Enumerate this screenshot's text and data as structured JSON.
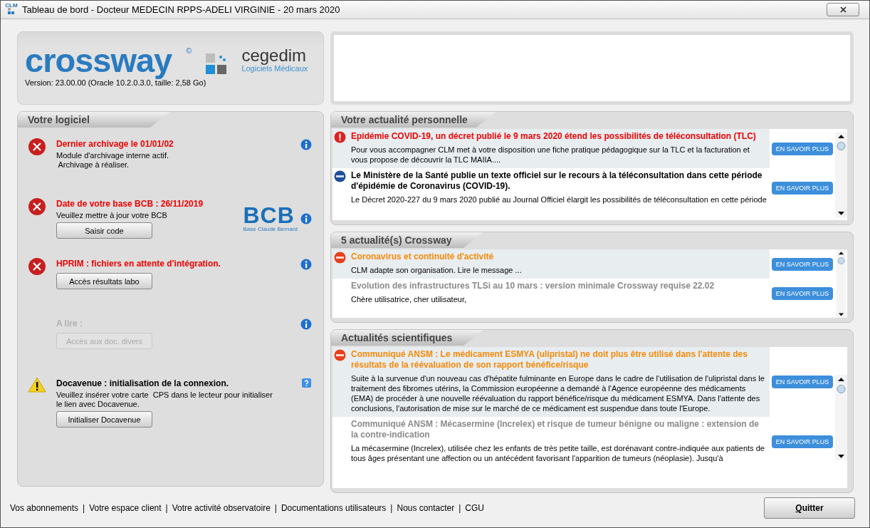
{
  "window": {
    "app_icon_text": "CLM",
    "title": "Tableau de bord  - Docteur MEDECIN RPPS-ADELI VIRGINIE - 20 mars 2020"
  },
  "brand": {
    "name": "crossway",
    "mark": "©",
    "partner": "cegedim",
    "partner_tagline": "Logiciels Médicaux",
    "version": "Version: 23.00.00 (Oracle 10.2.0.3.0, taille: 2,58 Go)"
  },
  "software": {
    "title": "Votre logiciel",
    "items": [
      {
        "kind": "error",
        "title": "Dernier archivage  le 01/01/02",
        "lines": [
          "Module d'archivage interne actif.",
          " Archivage à réaliser."
        ],
        "help": {
          "kind": "info"
        }
      },
      {
        "kind": "error",
        "title": "Date de votre base BCB :  26/11/2019",
        "lines": [
          "Veuillez mettre à jour votre BCB"
        ],
        "button": {
          "label": "Saisir code",
          "disabled": false
        },
        "logo": {
          "letters": "BCB",
          "caption": "Base Claude Bernard"
        },
        "help": {
          "kind": "info"
        }
      },
      {
        "kind": "error",
        "title": "HPRIM : fichiers en attente d'intégration.",
        "button": {
          "label": "Accès résultats labo",
          "disabled": false
        },
        "help": {
          "kind": "info"
        }
      },
      {
        "kind": "none",
        "title": "A lire :",
        "disabled": true,
        "button": {
          "label": "Accès aux doc. divers",
          "disabled": true
        },
        "help": {
          "kind": "info"
        }
      },
      {
        "kind": "warning",
        "title": "Docavenue : initialisation de la connexion.",
        "lines": [
          "Veuillez insérer votre carte  CPS dans le lecteur pour initialiser",
          "le lien avec Docavenue."
        ],
        "button": {
          "label": "Initialiser Docavenue",
          "disabled": false
        },
        "help": {
          "kind": "question"
        }
      }
    ]
  },
  "news_panels": [
    {
      "title": "Votre actualité personnelle",
      "items": [
        {
          "kind": "alert",
          "highlighted": true,
          "title": "Epidémie COVID-19, un décret publié le 9 mars 2020 étend les possibilités de téléconsultation (TLC)",
          "body": [
            "Pour vous accompagner CLM met à votre disposition une fiche pratique pédagogique sur la TLC et la facturation et vous propose de découvrir la TLC MAIIA...."
          ],
          "button": "EN SAVOIR PLUS"
        },
        {
          "kind": "notice",
          "highlighted": false,
          "title": "Le Ministère de la Santé publie un texte officiel sur le recours à la téléconsultation dans cette période d'épidémie de Coronavirus (COVID-19).",
          "body": [
            "Le Décret 2020-227 du 9 mars 2020 publié au Journal Officiel élargit les possibilités de téléconsultation en cette période"
          ],
          "button": "EN SAVOIR PLUS"
        }
      ]
    },
    {
      "title": "5 actualité(s) Crossway",
      "items": [
        {
          "kind": "new",
          "highlighted": true,
          "title": "Coronavirus et continuité d'activité",
          "body": [
            "CLM adapte son organisation. Lire le message ..."
          ],
          "button": "EN SAVOIR PLUS"
        },
        {
          "kind": "read",
          "highlighted": false,
          "title": "Evolution  des infrastructures TLSi  au 10 mars : version minimale Crossway requise  22.02",
          "body": [
            "Chère utilisatrice, cher utilisateur,"
          ],
          "button": "EN SAVOIR PLUS"
        }
      ]
    },
    {
      "title": "Actualités scientifiques",
      "items": [
        {
          "kind": "new",
          "highlighted": true,
          "title": "Communiqué ANSM : Le médicament ESMYA (ulipristal) ne doit plus être utilisé dans l'attente des résultats de la réévaluation de son rapport bénéfice/risque",
          "body": [
            "Suite à la survenue d'un nouveau cas d'hépatite fulminante en Europe dans le cadre de l'utilisation de l'ulipristal dans le traitement des fibromes utérins, la Commission européenne a demandé à l'Agence européenne des médicaments (EMA) de procéder à une nouvelle réévaluation du rapport bénéfice/risque du médicament ESMYA. Dans l'attente des conclusions, l'autorisation de mise sur le marché de ce médicament est suspendue dans toute l'Europe."
          ],
          "button": "EN SAVOIR PLUS"
        },
        {
          "kind": "read",
          "highlighted": false,
          "title": "Communiqué ANSM : Mécasermine (Increlex) et risque de tumeur bénigne ou maligne : extension de la contre-indication",
          "body": [
            "La mécasermine (Increlex), utilisée chez les enfants de très petite taille, est dorénavant contre-indiquée aux patients de tous âges présentant une affection ou un antécédent favorisant l'apparition de tumeurs (néoplasie). Jusqu'à"
          ],
          "button": "EN SAVOIR PLUS"
        }
      ]
    }
  ],
  "footer_links": [
    {
      "label": "Vos abonnements",
      "separator": "|"
    },
    {
      "label": "Votre espace client",
      "separator": "|"
    },
    {
      "label": "Votre activité observatoire",
      "separator": "|"
    },
    {
      "label": "Documentations utilisateurs",
      "separator": "|"
    },
    {
      "label": "Nous contacter",
      "separator": "|"
    },
    {
      "label": "CGU"
    }
  ],
  "quit_button": {
    "label": "Quitter"
  }
}
